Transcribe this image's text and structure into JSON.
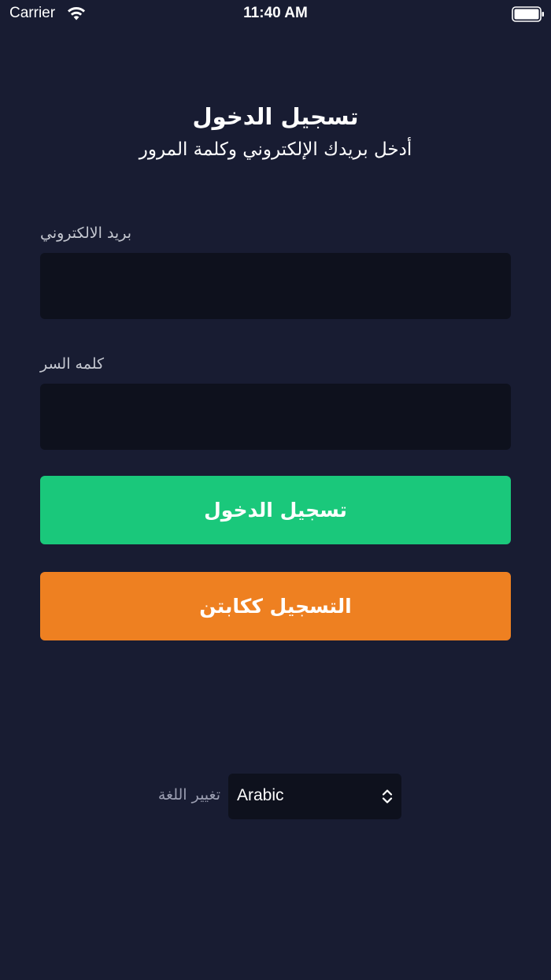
{
  "status_bar": {
    "carrier": "Carrier",
    "time": "11:40 AM",
    "icons": [
      "wifi-icon",
      "battery-icon"
    ]
  },
  "header": {
    "title": "تسجيل الدخول",
    "subtitle": "أدخل بريدك الإلكتروني وكلمة المرور"
  },
  "form": {
    "email_label": "بريد الالكتروني",
    "email_value": "",
    "password_label": "كلمه السر",
    "password_value": ""
  },
  "buttons": {
    "login": "تسجيل الدخول",
    "register_captain": "التسجيل ككابتن"
  },
  "language": {
    "label": "تغيير اللغة",
    "selected": "Arabic"
  },
  "colors": {
    "background": "#181c32",
    "input_background": "#0e111d",
    "login_button": "#1ac87b",
    "captain_button": "#ee8021"
  }
}
